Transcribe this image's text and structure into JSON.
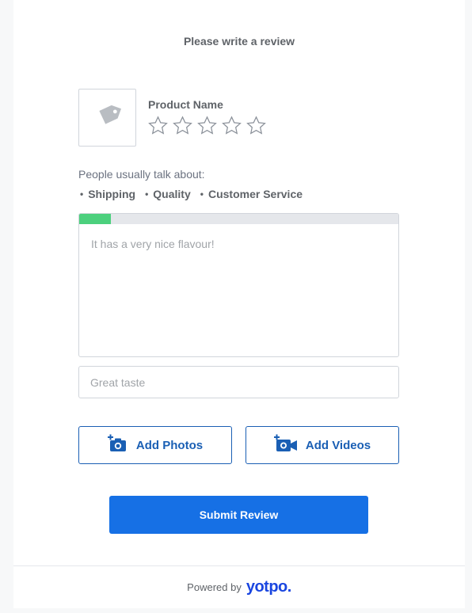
{
  "form": {
    "heading": "Please write a review",
    "product_name": "Product Name",
    "rating": {
      "selected": 0,
      "max": 5
    },
    "talk_label": "People usually talk about:",
    "topics": [
      "Shipping",
      "Quality",
      "Customer Service"
    ],
    "review_progress_fraction": 0.1,
    "review_placeholder": "It has a very nice flavour!",
    "title_placeholder": "Great taste",
    "add_photos_label": "Add Photos",
    "add_videos_label": "Add Videos",
    "submit_label": "Submit Review"
  },
  "footer": {
    "powered_by": "Powered by",
    "brand": "yotpo."
  },
  "colors": {
    "accent": "#1670e5",
    "outline_blue": "#1a5fb4",
    "progress_green": "#4cd07d",
    "brand_blue": "#1a46e0"
  },
  "icons": {
    "product": "tag-icon",
    "star": "star-outline-icon",
    "photo": "add-photo-icon",
    "video": "add-video-icon"
  }
}
